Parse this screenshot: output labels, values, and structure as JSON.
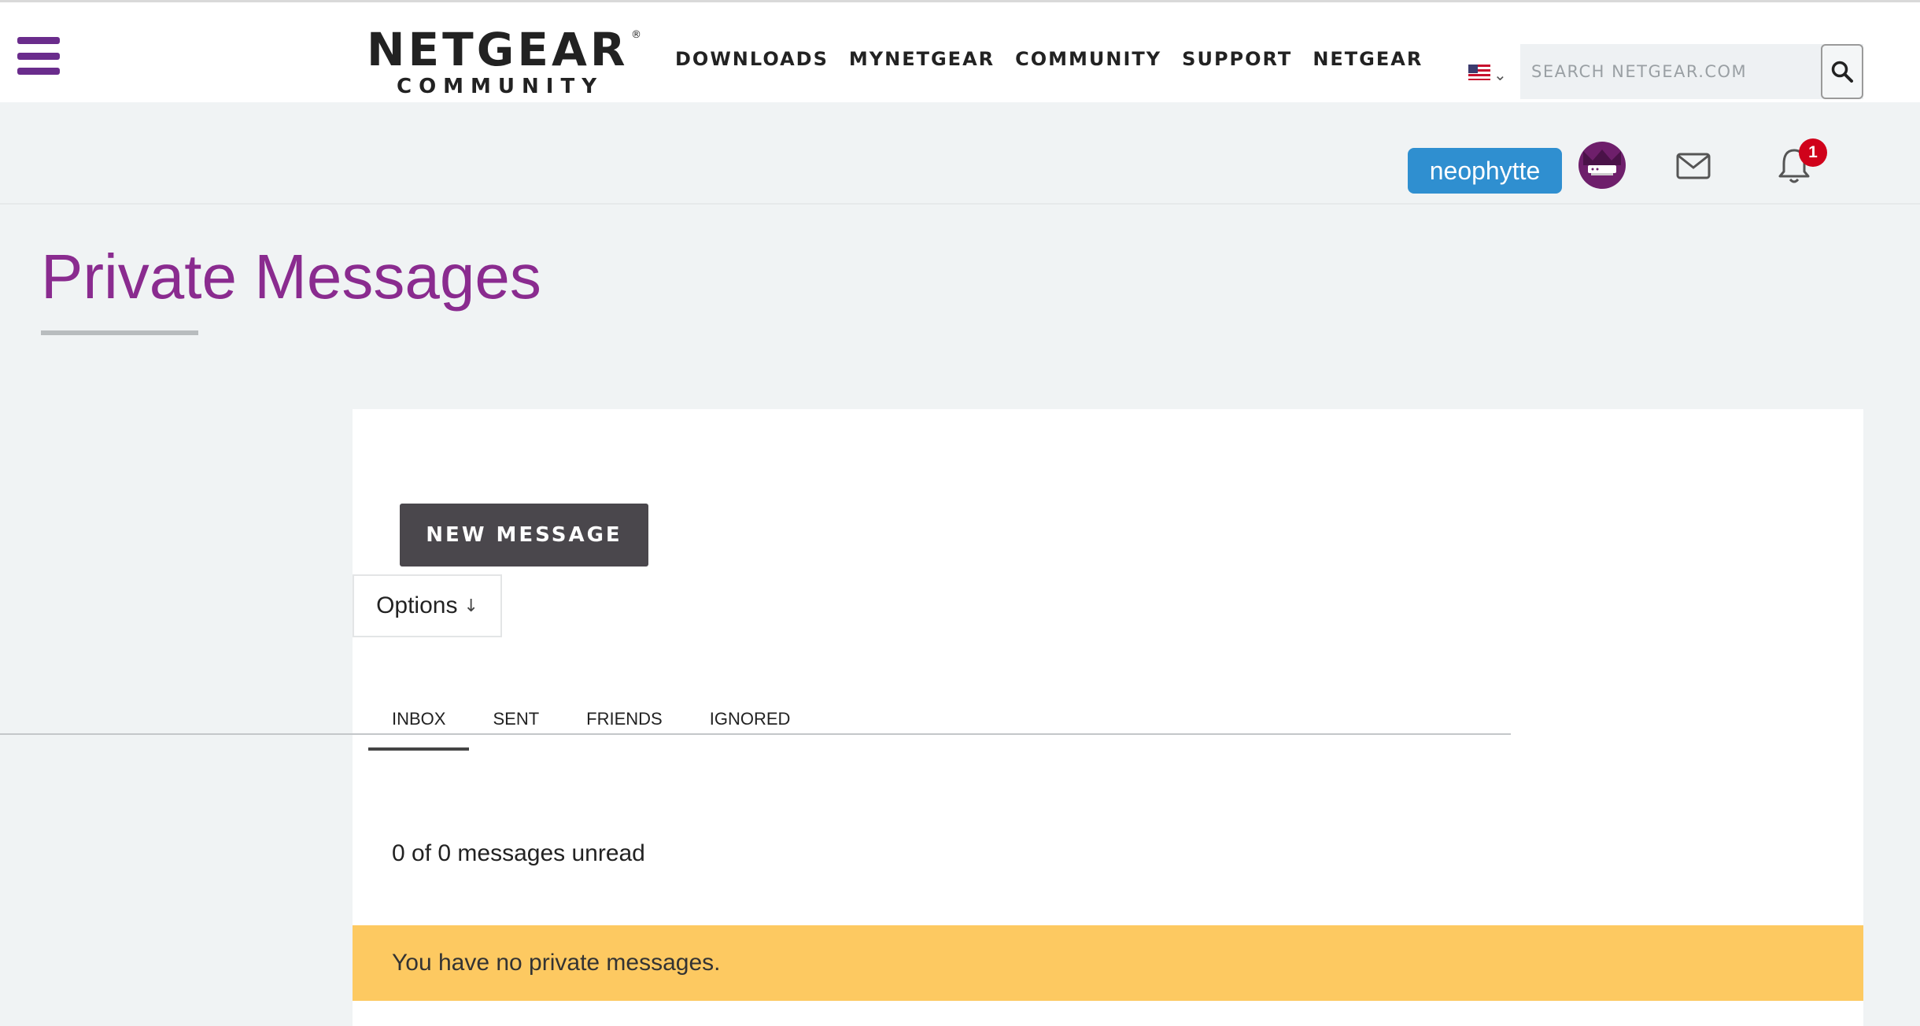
{
  "header": {
    "logo_main": "NETGEAR",
    "logo_reg": "®",
    "logo_sub": "COMMUNITY",
    "nav": [
      "DOWNLOADS",
      "MYNETGEAR",
      "COMMUNITY",
      "SUPPORT",
      "NETGEAR"
    ],
    "search_placeholder": "SEARCH NETGEAR.COM"
  },
  "userbar": {
    "username": "neophytte",
    "notification_count": "1"
  },
  "page": {
    "title": "Private Messages"
  },
  "messages": {
    "new_message_label": "NEW MESSAGE",
    "options_label": "Options",
    "tabs": [
      "INBOX",
      "SENT",
      "FRIENDS",
      "IGNORED"
    ],
    "active_tab": "INBOX",
    "unread_text": "0 of 0 messages unread",
    "empty_text": "You have no private messages."
  },
  "colors": {
    "brand_purple": "#8a2b8f",
    "user_pill": "#2f8fd0",
    "badge_red": "#d0021b",
    "empty_banner": "#fdc961",
    "button_dark": "#4a474c"
  },
  "icons": [
    "hamburger-menu-icon",
    "us-flag-icon",
    "chevron-down-icon",
    "search-icon",
    "avatar-router-icon",
    "mail-icon",
    "bell-icon",
    "arrow-down-icon"
  ]
}
